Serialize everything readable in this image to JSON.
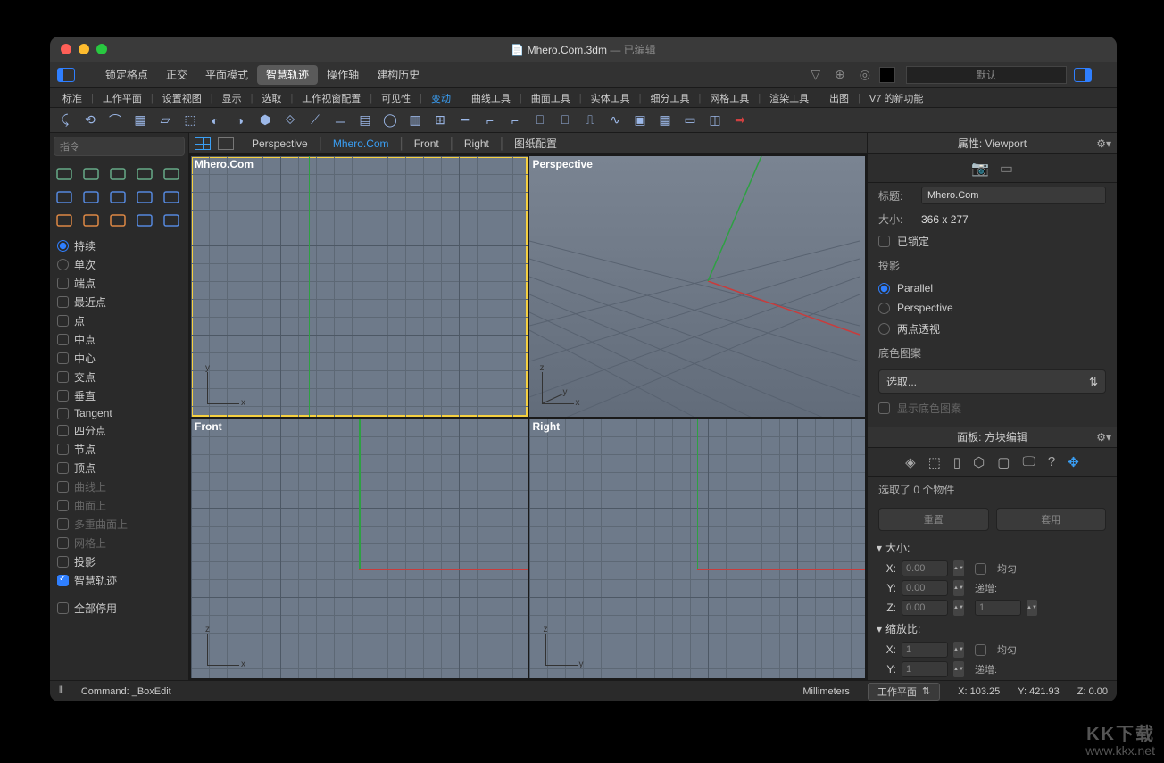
{
  "title": {
    "file": "Mhero.Com.3dm",
    "status": "已编辑"
  },
  "menubar": {
    "items": [
      "锁定格点",
      "正交",
      "平面模式",
      "智慧轨迹",
      "操作轴",
      "建构历史"
    ],
    "active": "智慧轨迹",
    "layer_default": "默认"
  },
  "tabs": {
    "items": [
      "标准",
      "工作平面",
      "设置视图",
      "显示",
      "选取",
      "工作视窗配置",
      "可见性",
      "变动",
      "曲线工具",
      "曲面工具",
      "实体工具",
      "细分工具",
      "网格工具",
      "渲染工具",
      "出图",
      "V7 的新功能"
    ],
    "active": "变动"
  },
  "command_placeholder": "指令",
  "snap": {
    "mode": [
      {
        "label": "持续",
        "on": true
      },
      {
        "label": "单次",
        "on": false
      }
    ],
    "items": [
      {
        "label": "端点",
        "on": false
      },
      {
        "label": "最近点",
        "on": false
      },
      {
        "label": "点",
        "on": false
      },
      {
        "label": "中点",
        "on": false
      },
      {
        "label": "中心",
        "on": false
      },
      {
        "label": "交点",
        "on": false
      },
      {
        "label": "垂直",
        "on": false
      },
      {
        "label": "Tangent",
        "on": false
      },
      {
        "label": "四分点",
        "on": false
      },
      {
        "label": "节点",
        "on": false
      },
      {
        "label": "顶点",
        "on": false
      },
      {
        "label": "曲线上",
        "on": false,
        "dim": true
      },
      {
        "label": "曲面上",
        "on": false,
        "dim": true
      },
      {
        "label": "多重曲面上",
        "on": false,
        "dim": true
      },
      {
        "label": "网格上",
        "on": false,
        "dim": true
      },
      {
        "label": "投影",
        "on": false
      },
      {
        "label": "智慧轨迹",
        "on": true
      }
    ],
    "disable_all": "全部停用"
  },
  "viewport_tabs": [
    "Perspective",
    "Mhero.Com",
    "Front",
    "Right",
    "图纸配置"
  ],
  "viewport_active_tab": "Mhero.Com",
  "viewports": {
    "tl": {
      "label": "Mhero.Com",
      "ax": [
        "x",
        "y"
      ]
    },
    "tr": {
      "label": "Perspective",
      "ax": [
        "x",
        "y",
        "z"
      ]
    },
    "bl": {
      "label": "Front",
      "ax": [
        "x",
        "z"
      ]
    },
    "br": {
      "label": "Right",
      "ax": [
        "y",
        "z"
      ]
    }
  },
  "props": {
    "title": "属性: Viewport",
    "title_label": "标题:",
    "title_val": "Mhero.Com",
    "size_label": "大小:",
    "size_val": "366 x 277",
    "locked_label": "已锁定",
    "projection_label": "投影",
    "proj_opts": [
      {
        "label": "Parallel",
        "on": true
      },
      {
        "label": "Perspective",
        "on": false
      },
      {
        "label": "两点透视",
        "on": false
      }
    ],
    "wallpaper_label": "底色图案",
    "select": "选取...",
    "show_wallpaper": "显示底色图案"
  },
  "boxedit": {
    "title": "面板: 方块编辑",
    "selcount": "选取了 0 个物件",
    "reset": "重置",
    "apply": "套用",
    "size_label": "大小:",
    "size": {
      "x": "0.00",
      "y": "0.00",
      "z": "0.00"
    },
    "uniform": "均匀",
    "increment": "递增:",
    "inc_val": "1",
    "scale_label": "缩放比:",
    "scale": {
      "x": "1",
      "y": "1"
    }
  },
  "status": {
    "cmd": "Command: _BoxEdit",
    "units": "Millimeters",
    "plane": "工作平面",
    "x": "X: 103.25",
    "y": "Y: 421.93",
    "z": "Z: 0.00"
  },
  "watermark": {
    "line1": "KK下载",
    "line2": "www.kkx.net"
  }
}
